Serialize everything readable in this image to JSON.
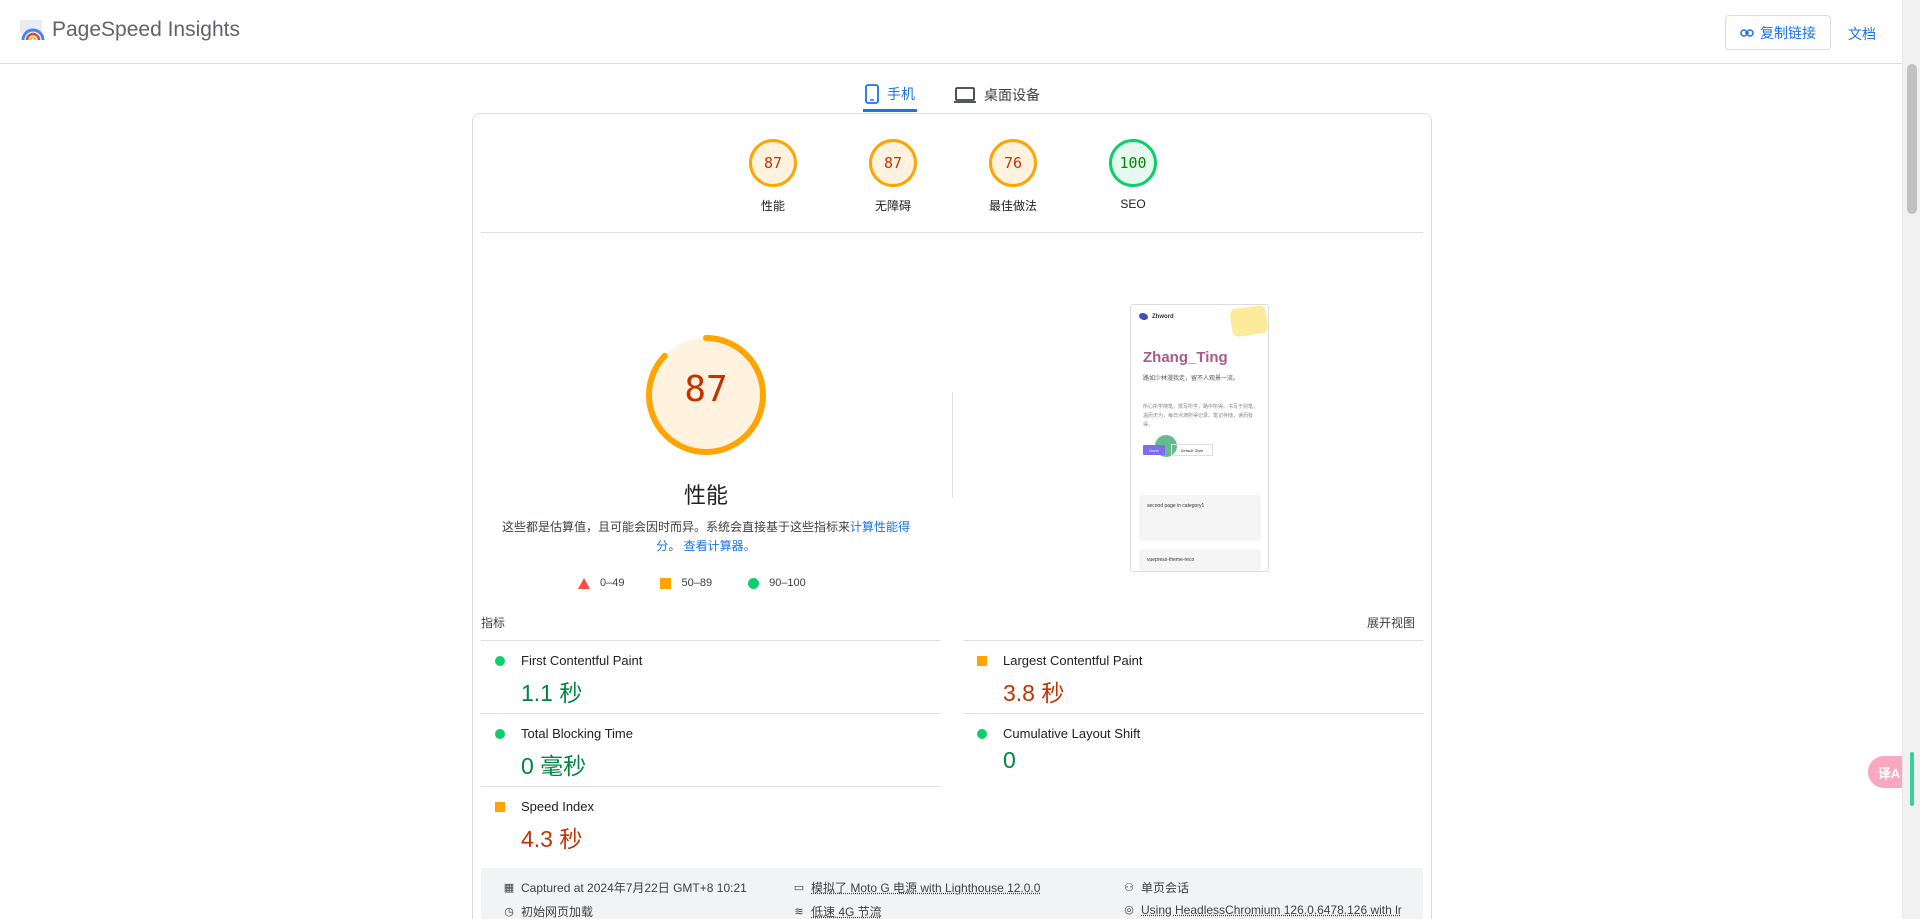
{
  "header": {
    "app_title": "PageSpeed Insights",
    "copy_link_label": "复制链接",
    "docs_label": "文档"
  },
  "tabs": [
    {
      "label": "手机",
      "active": true,
      "icon": "phone-icon"
    },
    {
      "label": "桌面设备",
      "active": false,
      "icon": "laptop-icon"
    }
  ],
  "categories": [
    {
      "score": "87",
      "label": "性能",
      "status": "average"
    },
    {
      "score": "87",
      "label": "无障碍",
      "status": "average"
    },
    {
      "score": "76",
      "label": "最佳做法",
      "status": "average"
    },
    {
      "score": "100",
      "label": "SEO",
      "status": "good"
    }
  ],
  "performance": {
    "score": "87",
    "score_fraction": 0.87,
    "title": "性能",
    "description_prefix": "这些都是估算值，且可能会因时而异。系统会直接基于这些指标来",
    "calc_link": "计算性能得分",
    "description_mid": "。",
    "calculator_link": "查看计算器。"
  },
  "legend": [
    {
      "label": "0–49",
      "shape": "triangle"
    },
    {
      "label": "50–89",
      "shape": "square"
    },
    {
      "label": "90–100",
      "shape": "circle"
    }
  ],
  "screenshot": {
    "site_name": "Zhword",
    "heading": "Zhang_Ting",
    "tagline": "路如少林漫我走，留不人观景一流。",
    "body": "所心所学随笔，撰写所学，路中所得。书写于别笔，温而无为，每日点滴所得记录。笔记存储，读而有得。",
    "btn_primary": "Gone",
    "btn_secondary": "Default Style",
    "card_title": "second page in category1",
    "card2_title": "vuepress-theme-reco"
  },
  "metrics_section": {
    "label": "指标",
    "expand_label": "展开视图"
  },
  "metrics": [
    {
      "name": "First Contentful Paint",
      "value": "1.1 秒",
      "status": "good"
    },
    {
      "name": "Largest Contentful Paint",
      "value": "3.8 秒",
      "status": "average"
    },
    {
      "name": "Total Blocking Time",
      "value": "0 毫秒",
      "status": "good"
    },
    {
      "name": "Cumulative Layout Shift",
      "value": "0",
      "status": "good"
    },
    {
      "name": "Speed Index",
      "value": "4.3 秒",
      "status": "average"
    }
  ],
  "info": {
    "captured": "Captured at 2024年7月22日 GMT+8 10:21",
    "device": "模拟了 Moto G 电源 with Lighthouse 12.0.0",
    "session": "单页会话",
    "initial_load": "初始网页加载",
    "network": "低速 4G 节流",
    "browser": "Using HeadlessChromium 126.0.6478.126 with lr"
  },
  "floating": {
    "label": "译A"
  },
  "colors": {
    "accent": "#1a73e8",
    "good": "#0cce6b",
    "average": "#ffa400",
    "poor": "#ff4e42"
  }
}
